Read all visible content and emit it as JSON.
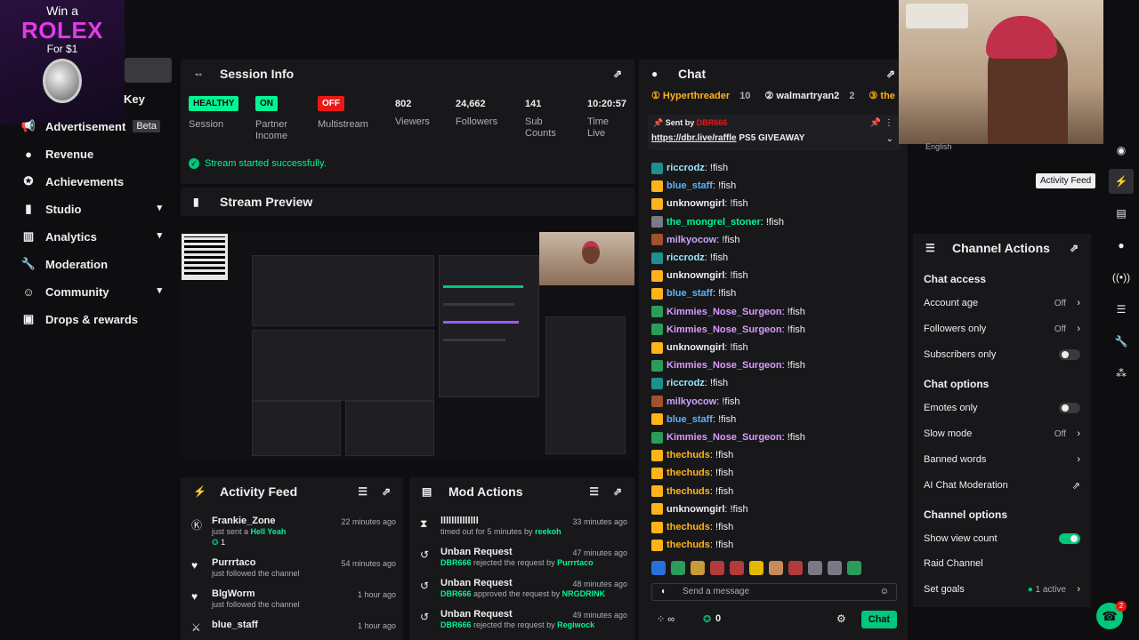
{
  "promo": {
    "line1": "Win a",
    "line2": "ROLEX",
    "line3": "For $1"
  },
  "nav": {
    "key_label": "Key",
    "items": [
      {
        "label": "Advertisement",
        "badge": "Beta",
        "icon": "megaphone-icon"
      },
      {
        "label": "Revenue",
        "icon": "coin-icon"
      },
      {
        "label": "Achievements",
        "icon": "trophy-icon"
      },
      {
        "label": "Studio",
        "icon": "video-icon"
      },
      {
        "label": "Analytics",
        "icon": "chart-icon"
      },
      {
        "label": "Moderation",
        "icon": "wrench-icon"
      },
      {
        "label": "Community",
        "icon": "people-icon"
      },
      {
        "label": "Drops & rewards",
        "icon": "gift-icon"
      }
    ]
  },
  "session": {
    "title": "Session Info",
    "stats": [
      {
        "badge": "HEALTHY",
        "badge_color": "#00f593",
        "label": "Session"
      },
      {
        "badge": "ON",
        "badge_color": "#00f593",
        "label": "Partner Income"
      },
      {
        "badge": "OFF",
        "badge_color": "#e91916",
        "label": "Multistream"
      },
      {
        "value": "802",
        "label": "Viewers"
      },
      {
        "value": "24,662",
        "label": "Followers"
      },
      {
        "value": "141",
        "label": "Sub Counts"
      },
      {
        "value": "10:20:57",
        "label": "Time Live"
      }
    ],
    "status": "Stream started successfully."
  },
  "preview": {
    "title": "Stream Preview"
  },
  "activity": {
    "title": "Activity Feed",
    "items": [
      {
        "who": "Frankie_Zone",
        "when": "22 minutes ago",
        "pre": "just sent a",
        "hl": "Hell Yeah",
        "extra": "1"
      },
      {
        "who": "Purrrtaco",
        "when": "54 minutes ago",
        "pre": "just followed the channel",
        "hl": "",
        "extra": ""
      },
      {
        "who": "BlgWorm",
        "when": "1 hour ago",
        "pre": "just followed the channel",
        "hl": "",
        "extra": ""
      },
      {
        "who": "blue_staff",
        "when": "1 hour ago",
        "pre": "",
        "hl": "",
        "extra": ""
      }
    ]
  },
  "mod": {
    "title": "Mod Actions",
    "items": [
      {
        "who": "llllllllllllll",
        "when": "33 minutes ago",
        "pre": "timed out for 5 minutes by",
        "hl": "reekoh",
        "actor": ""
      },
      {
        "who": "Unban Request",
        "when": "47 minutes ago",
        "actor": "DBR666",
        "pre": "rejected the request by",
        "hl": "Purrrtaco"
      },
      {
        "who": "Unban Request",
        "when": "48 minutes ago",
        "actor": "DBR666",
        "pre": "approved the request by",
        "hl": "NRGDRINK"
      },
      {
        "who": "Unban Request",
        "when": "49 minutes ago",
        "actor": "DBR666",
        "pre": "rejected the request by",
        "hl": "Regiwock"
      }
    ]
  },
  "chat": {
    "title": "Chat",
    "top_chatters": [
      {
        "name": "Hyperthreader",
        "count": "10",
        "color": "#ffb31a"
      },
      {
        "name": "walmartryan2",
        "count": "2",
        "color": "#efeff1"
      },
      {
        "name": "the",
        "count": "",
        "color": "#ffb31a"
      }
    ],
    "pinned_sent_by": "Sent by",
    "pinned_user": "DBR666",
    "pinned_link": "https://dbr.live/raffle",
    "pinned_text": "PS5 GIVEAWAY",
    "messages": [
      {
        "name": "riccrodz",
        "color": "#9ae9ff",
        "text": ": !fish",
        "badge": "#1e8f8f"
      },
      {
        "name": "blue_staff",
        "color": "#5ab4ff",
        "text": ": !fish",
        "badge": "#ffb31a"
      },
      {
        "name": "unknowngirl",
        "color": "#efeff1",
        "text": ": !fish",
        "badge": "#ffb31a"
      },
      {
        "name": "the_mongrel_stoner",
        "color": "#00f593",
        "text": ": !fish",
        "badge": "#7a7a85"
      },
      {
        "name": "milkyocow",
        "color": "#c9a5ff",
        "text": ": !fish",
        "badge": "#a0522d"
      },
      {
        "name": "riccrodz",
        "color": "#9ae9ff",
        "text": ": !fish",
        "badge": "#1e8f8f"
      },
      {
        "name": "unknowngirl",
        "color": "#efeff1",
        "text": ": !fish",
        "badge": "#ffb31a"
      },
      {
        "name": "blue_staff",
        "color": "#5ab4ff",
        "text": ": !fish",
        "badge": "#ffb31a"
      },
      {
        "name": "Kimmies_Nose_Surgeon",
        "color": "#d79bff",
        "text": ": !fish",
        "badge": "#2c9c5a"
      },
      {
        "name": "Kimmies_Nose_Surgeon",
        "color": "#d79bff",
        "text": ": !fish",
        "badge": "#2c9c5a"
      },
      {
        "name": "unknowngirl",
        "color": "#efeff1",
        "text": ": !fish",
        "badge": "#ffb31a"
      },
      {
        "name": "Kimmies_Nose_Surgeon",
        "color": "#d79bff",
        "text": ": !fish",
        "badge": "#2c9c5a"
      },
      {
        "name": "riccrodz",
        "color": "#9ae9ff",
        "text": ": !fish",
        "badge": "#1e8f8f"
      },
      {
        "name": "milkyocow",
        "color": "#c9a5ff",
        "text": ": !fish",
        "badge": "#a0522d"
      },
      {
        "name": "blue_staff",
        "color": "#5ab4ff",
        "text": ": !fish",
        "badge": "#ffb31a"
      },
      {
        "name": "Kimmies_Nose_Surgeon",
        "color": "#d79bff",
        "text": ": !fish",
        "badge": "#2c9c5a"
      },
      {
        "name": "thechuds",
        "color": "#ffb31a",
        "text": ": !fish",
        "badge": "#ffb31a"
      },
      {
        "name": "thechuds",
        "color": "#ffb31a",
        "text": ": !fish",
        "badge": "#ffb31a"
      },
      {
        "name": "thechuds",
        "color": "#ffb31a",
        "text": ": !fish",
        "badge": "#ffb31a"
      },
      {
        "name": "unknowngirl",
        "color": "#efeff1",
        "text": ": !fish",
        "badge": "#ffb31a"
      },
      {
        "name": "thechuds",
        "color": "#ffb31a",
        "text": ": !fish",
        "badge": "#ffb31a"
      },
      {
        "name": "thechuds",
        "color": "#ffb31a",
        "text": ": !fish",
        "badge": "#ffb31a"
      }
    ],
    "input_placeholder": "Send a message",
    "points": "0",
    "send_label": "Chat"
  },
  "english_label": "English",
  "tooltip": "Activity Feed",
  "channel_actions": {
    "title": "Channel Actions",
    "sec_access": "Chat access",
    "account_age": "Account age",
    "account_age_val": "Off",
    "followers_only": "Followers only",
    "followers_only_val": "Off",
    "subscribers_only": "Subscribers only",
    "sec_options": "Chat options",
    "emotes_only": "Emotes only",
    "slow_mode": "Slow mode",
    "slow_mode_val": "Off",
    "banned_words": "Banned words",
    "ai_mod": "AI Chat Moderation",
    "sec_channel": "Channel options",
    "show_view_count": "Show view count",
    "raid_channel": "Raid Channel",
    "set_goals": "Set goals",
    "set_goals_val": "1 active"
  },
  "help_count": "2"
}
